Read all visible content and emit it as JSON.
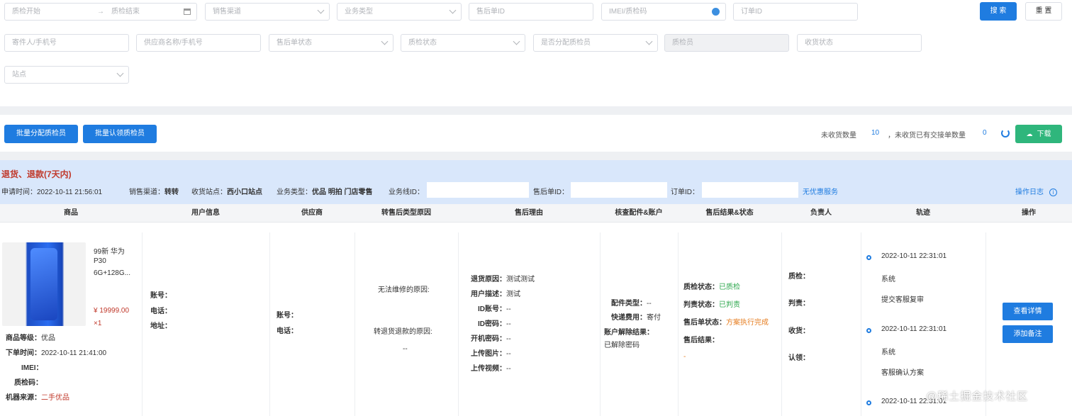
{
  "filters": {
    "row1": {
      "qc_start": "质检开始",
      "arrow": "→",
      "qc_end": "质检结束",
      "sales_channel": "销售渠道",
      "business_type": "业务类型",
      "after_sale_id": "售后单ID",
      "imei": "IMEI/质检码",
      "order_id": "订单ID",
      "search_label": "搜 索",
      "reset_label": "重 置"
    },
    "row2": {
      "sender": "寄件人/手机号",
      "supplier": "供应商名称/手机号",
      "after_sale_status": "售后单状态",
      "qc_status": "质检状态",
      "assigned": "是否分配质检员",
      "inspector": "质检员",
      "receive_status": "收货状态"
    },
    "row3": {
      "site": "站点"
    }
  },
  "toolbar": {
    "batch_assign": "批量分配质检员",
    "batch_claim": "批量认领质检员",
    "unreceived_label": "未收货数量",
    "unreceived_count": "10",
    "handover_label": "，未收货已有交接单数量",
    "handover_count": "0",
    "download_label": "下载"
  },
  "order": {
    "title": "退货、退款(7天内)",
    "apply_time_label": "申请时间：",
    "apply_time": "2022-10-11 21:56:01",
    "channel_label": "销售渠道：",
    "channel": "转转",
    "site_label": "收货站点：",
    "site": "西小口站点",
    "btype_label": "业务类型：",
    "btype": "优品 明拍 门店零售",
    "line_id_label": "业务线ID：",
    "after_id_label": "售后单ID：",
    "order_id_label": "订单ID：",
    "no_service": "无优惠服务",
    "log": "操作日志",
    "info_icon": "i"
  },
  "columns": [
    "商品",
    "用户信息",
    "供应商",
    "转售后类型原因",
    "售后理由",
    "核查配件&账户",
    "售后结果&状态",
    "负责人",
    "轨迹",
    "操作"
  ],
  "product": {
    "name1": "99新 华为",
    "name2": "P30",
    "name3": "6G+128G...",
    "price": "¥ 19999.00",
    "qty": "×1",
    "grade_label": "商品等级：",
    "grade": "优品",
    "order_time_label": "下单时间：",
    "order_time": "2022-10-11 21:41:00",
    "imei_label": "IMEI：",
    "qc_code_label": "质检码：",
    "source_label": "机器来源：",
    "source": "二手优品"
  },
  "user": {
    "account": "账号：",
    "phone": "电话：",
    "address": "地址："
  },
  "supplier": {
    "account": "账号：",
    "phone": "电话："
  },
  "resale": {
    "unrepairable": "无法维修的原因:",
    "refund_reason": "转退货退款的原因:",
    "dash": "--"
  },
  "reason": {
    "return_reason_label": "退货原因：",
    "return_reason": "测试测试",
    "desc_label": "用户描述：",
    "desc": "测试",
    "id_account_label": "ID账号：",
    "id_account": "--",
    "id_pwd_label": "ID密码：",
    "id_pwd": "--",
    "boot_pwd_label": "开机密码：",
    "boot_pwd": "--",
    "pic_label": "上传图片：",
    "pic": "--",
    "video_label": "上传视频：",
    "video": "--"
  },
  "accessory": {
    "type_label": "配件类型：",
    "type": "--",
    "fee_label": "快递费用：",
    "fee": "寄付",
    "unlock_label": "账户解除结果：",
    "unlock": "已解除密码"
  },
  "result": {
    "qc_label": "质检状态：",
    "qc": "已质检",
    "duty_label": "判责状态：",
    "duty": "已判责",
    "after_label": "售后单状态：",
    "after": "方案执行完成",
    "result_label": "售后结果：",
    "result": "-"
  },
  "owner": {
    "qc": "质检：",
    "duty": "判责：",
    "receive": "收货：",
    "claim": "认领："
  },
  "track": [
    {
      "time": "2022-10-11 22:31:01",
      "actor": "系统",
      "action": "提交客服复审"
    },
    {
      "time": "2022-10-11 22:31:01",
      "actor": "系统",
      "action": "客服确认方案"
    },
    {
      "time": "2022-10-11 22:31:01"
    }
  ],
  "actions": {
    "detail": "查看详情",
    "remark": "添加备注"
  },
  "watermark": "@稀土掘金技术社区"
}
